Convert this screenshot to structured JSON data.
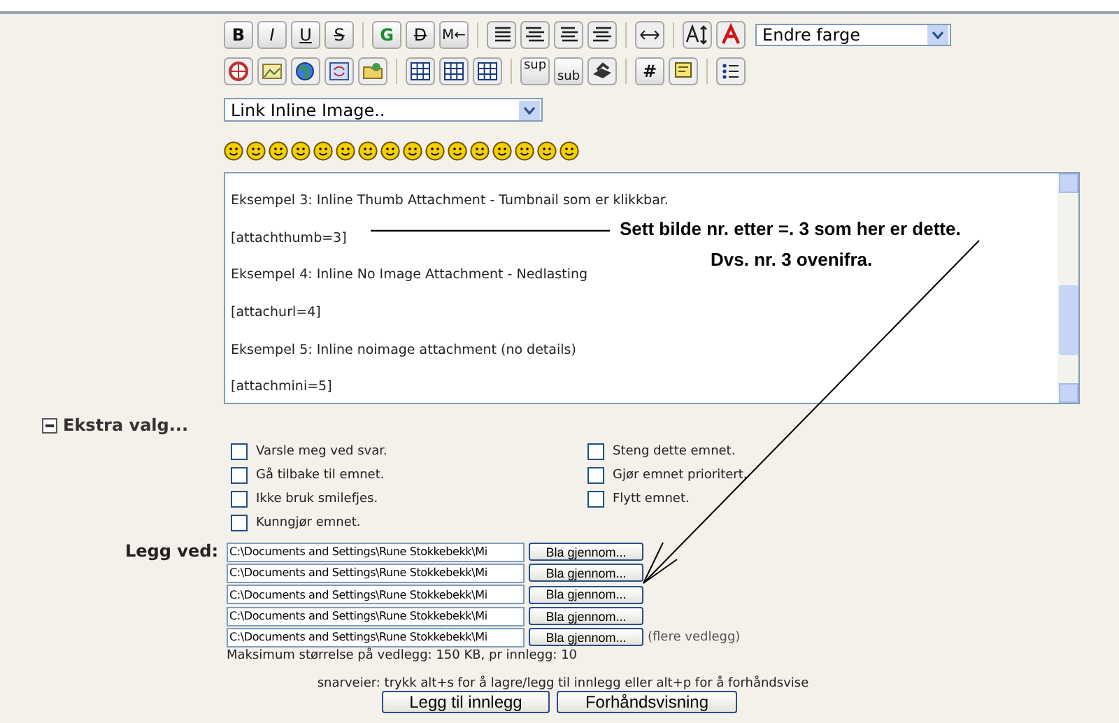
{
  "toolbar": {
    "text_buttons": [
      "B",
      "I",
      "U",
      "S",
      "G",
      "D",
      "M←"
    ],
    "color_select": "Endre farge",
    "script_buttons": [
      "sup",
      "sub"
    ],
    "hash_button": "#"
  },
  "link_select": "Link Inline Image..",
  "message_lines": [
    "Eksempel 3: Inline Thumb Attachment - Tumbnail som er klikkbar.",
    "[attachthumb=3]",
    "Eksempel 4: Inline No Image Attachment - Nedlasting",
    "[attachurl=4]",
    "Eksempel 5: Inline noimage attachment (no details)",
    "[attachmini=5]"
  ],
  "annotation": [
    "Sett bilde nr. etter =. 3 som her er dette.",
    "Dvs. nr. 3 ovenifra."
  ],
  "extra_options": {
    "title": "Ekstra valg...",
    "expanded": true,
    "left": [
      {
        "label": "Varsle meg ved svar.",
        "checked": false
      },
      {
        "label": "Gå tilbake til emnet.",
        "checked": false
      },
      {
        "label": "Ikke bruk smilefjes.",
        "checked": false
      },
      {
        "label": "Kunngjør emnet.",
        "checked": false
      }
    ],
    "right": [
      {
        "label": "Steng dette emnet.",
        "checked": false
      },
      {
        "label": "Gjør emnet prioritert.",
        "checked": false
      },
      {
        "label": "Flytt emnet.",
        "checked": false
      }
    ]
  },
  "attachments": {
    "label": "Legg ved:",
    "files": [
      {
        "value": "C:\\Documents and Settings\\Rune Stokkebekk\\Mi",
        "button": "Bla gjennom..."
      },
      {
        "value": "C:\\Documents and Settings\\Rune Stokkebekk\\Mi",
        "button": "Bla gjennom..."
      },
      {
        "value": "C:\\Documents and Settings\\Rune Stokkebekk\\Mi",
        "button": "Bla gjennom..."
      },
      {
        "value": "C:\\Documents and Settings\\Rune Stokkebekk\\Mi",
        "button": "Bla gjennom..."
      },
      {
        "value": "C:\\Documents and Settings\\Rune Stokkebekk\\Mi",
        "button": "Bla gjennom..."
      }
    ],
    "more_link": "(flere vedlegg)",
    "limit": "Maksimum størrelse på vedlegg: 150 KB, pr innlegg: 10"
  },
  "shortcuts": "snarveier: trykk alt+s for å lagre/legg til innlegg eller alt+p for å forhåndsvise",
  "buttons": [
    "Legg til innlegg",
    "Forhåndsvisning"
  ]
}
